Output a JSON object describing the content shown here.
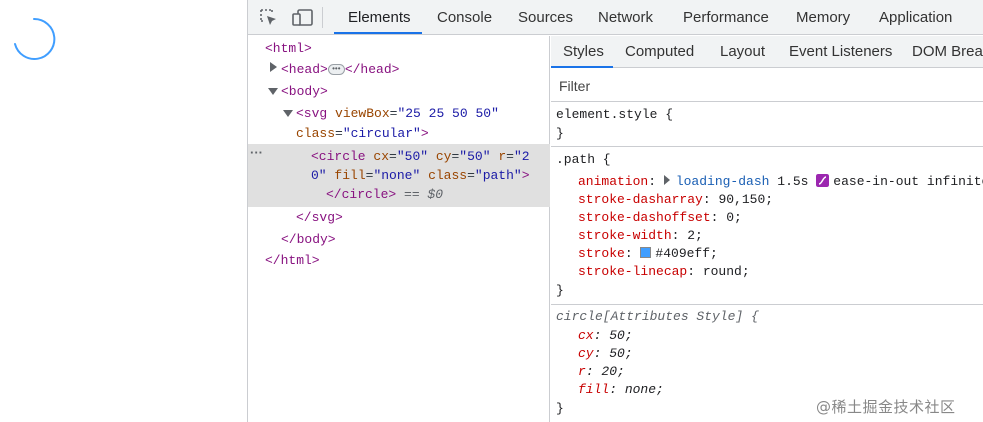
{
  "toolbar": {
    "tabs": [
      "Elements",
      "Console",
      "Sources",
      "Network",
      "Performance",
      "Memory",
      "Application"
    ],
    "active_tab": "Elements"
  },
  "elements_tree": {
    "html_open": "<html>",
    "head_open": "<head>",
    "head_close": "</head>",
    "body_open": "<body>",
    "svg_tag": "<svg",
    "svg_attr1_name": "viewBox",
    "svg_attr1_value": "\"25 25 50 50\"",
    "svg_attr2_name": "class",
    "svg_attr2_value": "\"circular\"",
    "circle_tag": "<circle",
    "cx_name": "cx",
    "cx_value": "\"50\"",
    "cy_name": "cy",
    "cy_value": "\"50\"",
    "r_name": "r",
    "r_value_part1": "\"2",
    "r_value_part2": "0\"",
    "fill_name": "fill",
    "fill_value": "\"none\"",
    "class_name": "class",
    "class_value": "\"path\"",
    "circle_close": "</circle>",
    "selected_marker": "== $0",
    "svg_close": "</svg>",
    "body_close": "</body>",
    "html_close": "</html>"
  },
  "styles": {
    "subtabs": [
      "Styles",
      "Computed",
      "Layout",
      "Event Listeners",
      "DOM Breakpoints"
    ],
    "active_subtab": "Styles",
    "filter_placeholder": "Filter",
    "element_style_selector": "element.style {",
    "path_selector": ".path {",
    "path_props": [
      {
        "name": "animation",
        "value_link": "loading-dash",
        "value_rest": "1.5s",
        "value_tail": "ease-in-out infinite"
      },
      {
        "name": "stroke-dasharray",
        "value": "90,150;"
      },
      {
        "name": "stroke-dashoffset",
        "value": "0;"
      },
      {
        "name": "stroke-width",
        "value": "2;"
      },
      {
        "name": "stroke",
        "value": "#409eff;",
        "swatch_color": "#409eff"
      },
      {
        "name": "stroke-linecap",
        "value": "round;"
      }
    ],
    "attr_selector": "circle[Attributes Style] {",
    "attr_props": [
      {
        "name": "cx",
        "value": "50;"
      },
      {
        "name": "cy",
        "value": "50;"
      },
      {
        "name": "r",
        "value": "20;"
      },
      {
        "name": "fill",
        "value": "none;"
      }
    ],
    "close_brace": "}"
  },
  "watermark": "@稀土掘金技术社区",
  "colors": {
    "accent": "#1a73e8",
    "spinner": "#409eff",
    "selection": "#e0e0e0"
  }
}
